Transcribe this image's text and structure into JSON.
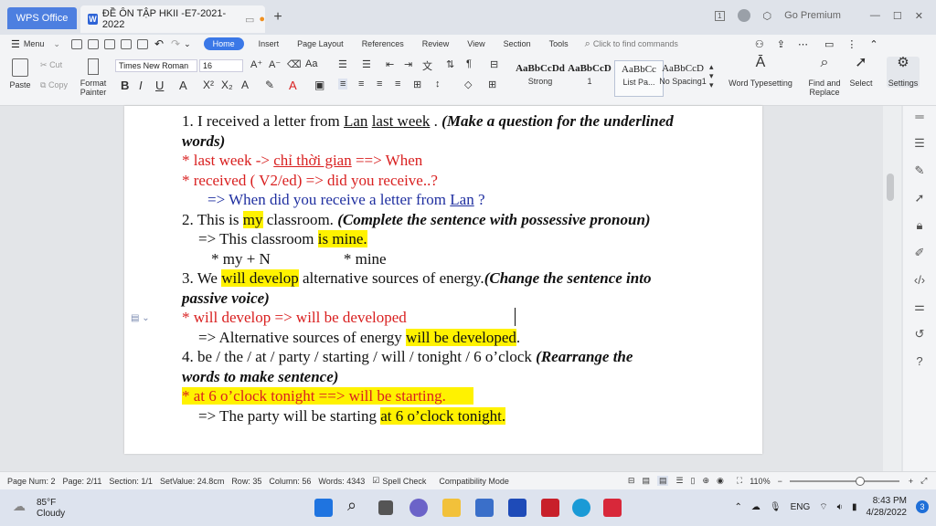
{
  "titlebar": {
    "app_tab": "WPS Office",
    "doc_tab": "ĐỀ ÔN TẬP HKII -E7-2021-2022",
    "premium": "Go Premium"
  },
  "menu": {
    "menu_label": "Menu",
    "tabs": [
      "Home",
      "Insert",
      "Page Layout",
      "References",
      "Review",
      "View",
      "Section",
      "Tools"
    ],
    "find_placeholder": "Click to find commands"
  },
  "ribbon": {
    "paste": "Paste",
    "cut": "Cut",
    "copy": "Copy",
    "format_painter_1": "Format",
    "format_painter_2": "Painter",
    "font_name": "Times New Roman",
    "font_size": "16",
    "styles": [
      {
        "sample": "AaBbCcDd",
        "name": "Strong"
      },
      {
        "sample": "AaBbCcD",
        "name": "1"
      },
      {
        "sample": "AaBbCc",
        "name": "List Pa..."
      },
      {
        "sample": "AaBbCcD",
        "name": "No Spacing1"
      }
    ],
    "word_typesetting": "Word Typesetting",
    "find_replace_1": "Find and",
    "find_replace_2": "Replace",
    "select": "Select",
    "settings": "Settings"
  },
  "document": {
    "l1a": "1. I received a letter from ",
    "l1b": "Lan",
    "l1c": " ",
    "l1d": "last week",
    "l1e": " .  ",
    "l1f": "(Make a question for the underlined",
    "l2": "words)",
    "l3a": "* last week -> ",
    "l3b": "chỉ thời gian",
    "l3c": " ==> When",
    "l4": "* received ( V2/ed) => did you receive..?",
    "l5a": "=> When did you receive a letter from ",
    "l5b": "Lan",
    "l5c": " ?",
    "l6a": "2. This is ",
    "l6b": "my",
    "l6c": " classroom. ",
    "l6d": "(Complete the sentence with possessive pronoun)",
    "l7a": "=> This classroom ",
    "l7b": "is mine.",
    "l8a": "* my + N",
    "l8b": "* mine",
    "l9a": "3.     We ",
    "l9b": "will develop",
    "l9c": " alternative sources of energy.",
    "l9d": "(Change the sentence into",
    "l10": "passive voice)",
    "l11": "* will develop    => will be developed",
    "l12a": "=> Alternative sources of energy ",
    "l12b": "will be developed",
    "l12c": ".",
    "l13a": "4.     be / the / at / party / starting / will / tonight / 6 o’clock  ",
    "l13b": "(Rearrange the",
    "l14": "words to make sentence)",
    "l15": "* at 6 o’clock tonight  ==> will be starting.",
    "l16a": "=> The party will be starting ",
    "l16b": "at 6 o’clock tonight."
  },
  "status": {
    "page_num": "Page Num: 2",
    "page": "Page: 2/11",
    "section": "Section: 1/1",
    "setvalue": "SetValue: 24.8cm",
    "row": "Row: 35",
    "column": "Column: 56",
    "words": "Words: 4343",
    "spell": "Spell Check",
    "compat": "Compatibility Mode",
    "zoom": "110%"
  },
  "taskbar": {
    "temp": "85°F",
    "weather": "Cloudy",
    "lang": "ENG",
    "time": "8:43 PM",
    "date": "4/28/2022",
    "badge": "3"
  },
  "colors": {
    "accent": "#3b78e7",
    "highlight": "#fff200",
    "red_text": "#d92020",
    "blue_text": "#1f2fa0"
  }
}
